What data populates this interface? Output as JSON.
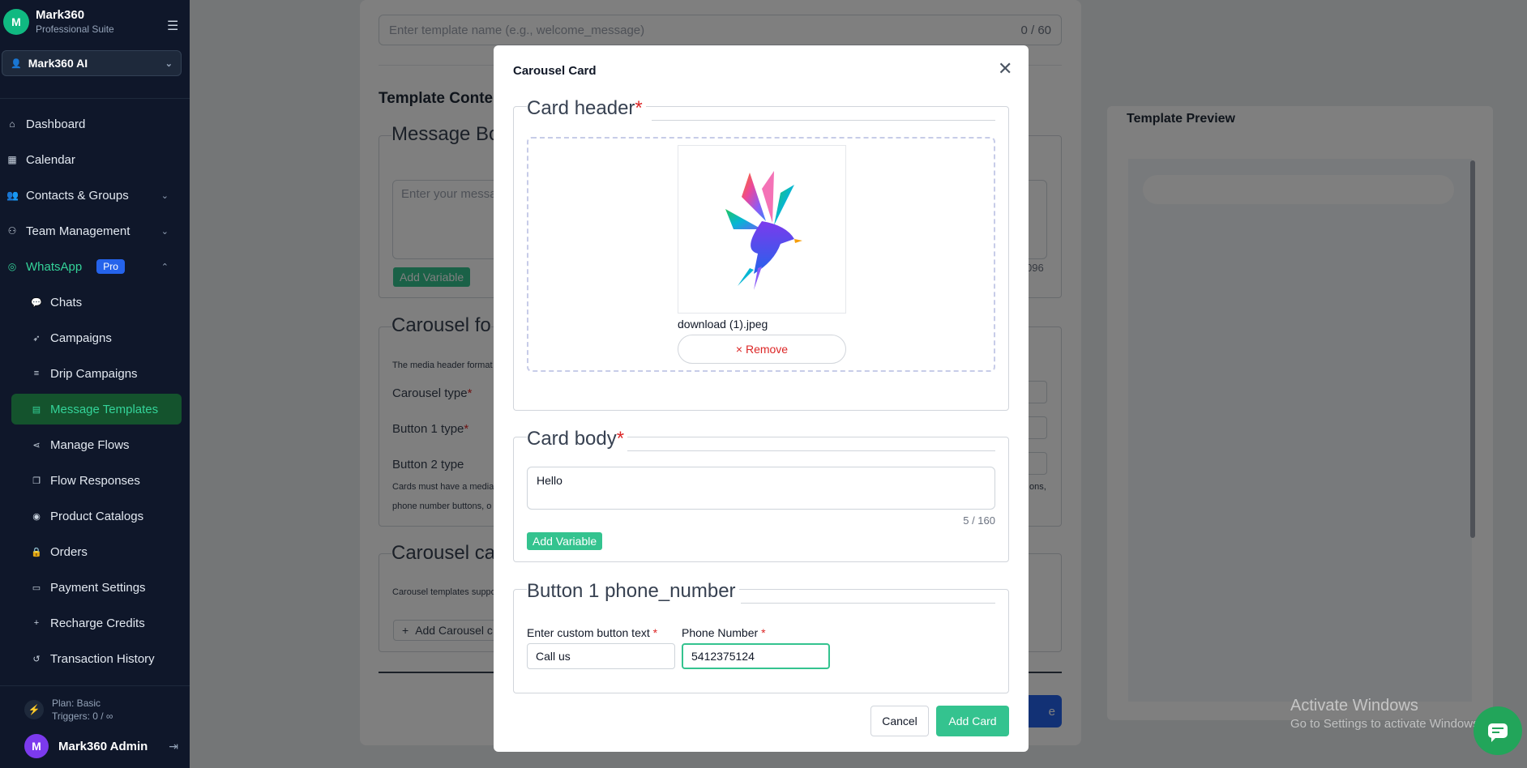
{
  "sidebar": {
    "brand_initials": "M",
    "brand_name": "Mark360",
    "brand_sub": "Professional Suite",
    "workspace": "Mark360 AI",
    "nav": [
      {
        "label": "Dashboard"
      },
      {
        "label": "Calendar"
      },
      {
        "label": "Contacts & Groups"
      },
      {
        "label": "Team Management"
      },
      {
        "label": "WhatsApp",
        "badge": "Pro"
      }
    ],
    "sub": [
      {
        "label": "Chats"
      },
      {
        "label": "Campaigns"
      },
      {
        "label": "Drip Campaigns"
      },
      {
        "label": "Message Templates"
      },
      {
        "label": "Manage Flows"
      },
      {
        "label": "Flow Responses"
      },
      {
        "label": "Product Catalogs"
      },
      {
        "label": "Orders"
      },
      {
        "label": "Payment Settings"
      },
      {
        "label": "Recharge Credits"
      },
      {
        "label": "Transaction History"
      }
    ],
    "plan_line1": "Plan: Basic",
    "plan_line2": "Triggers: 0 / ∞",
    "user_initial": "M",
    "user_name": "Mark360 Admin"
  },
  "background": {
    "template_name_placeholder": "Enter template name (e.g., welcome_message)",
    "template_name_count": "0 / 60",
    "template_content_title": "Template Conte",
    "message_body_legend": "Message Bo",
    "message_placeholder": "Enter your messag",
    "message_count": "096",
    "add_variable": "Add Variable",
    "carousel_format_legend": "Carousel fo",
    "media_header_note": "The media header format",
    "carousel_type_label": "Carousel type",
    "button1_type_label": "Button 1 type",
    "button2_type_label": "Button 2 type",
    "cards_note_1": "Cards must have a media",
    "cards_note_1_end": "ons,",
    "cards_note_2": "phone number buttons, o",
    "carousel_cards_legend": "Carousel ca",
    "carousel_support_note": "Carousel templates suppo",
    "add_carousel_card": "Add Carousel c",
    "submit_fragment": "e",
    "preview_title": "Template Preview"
  },
  "modal": {
    "title": "Carousel Card",
    "card_header_legend": "Card header",
    "file_name": "download (1).jpeg",
    "remove_label": "× Remove",
    "card_body_legend": "Card body",
    "body_value": "Hello",
    "body_count": "5 / 160",
    "add_variable": "Add Variable",
    "button_legend": "Button 1 phone_number",
    "button_text_label": "Enter custom button text",
    "button_text_value": "Call us",
    "phone_label": "Phone Number",
    "phone_value": "5412375124",
    "cancel": "Cancel",
    "add_card": "Add Card"
  },
  "watermark": {
    "line1": "Activate Windows",
    "line2": "Go to Settings to activate Windows."
  },
  "colors": {
    "sidebar_bg": "#0f172a",
    "accent_green": "#34c38f",
    "required_red": "#dc2626",
    "pro_badge": "#2563eb"
  }
}
